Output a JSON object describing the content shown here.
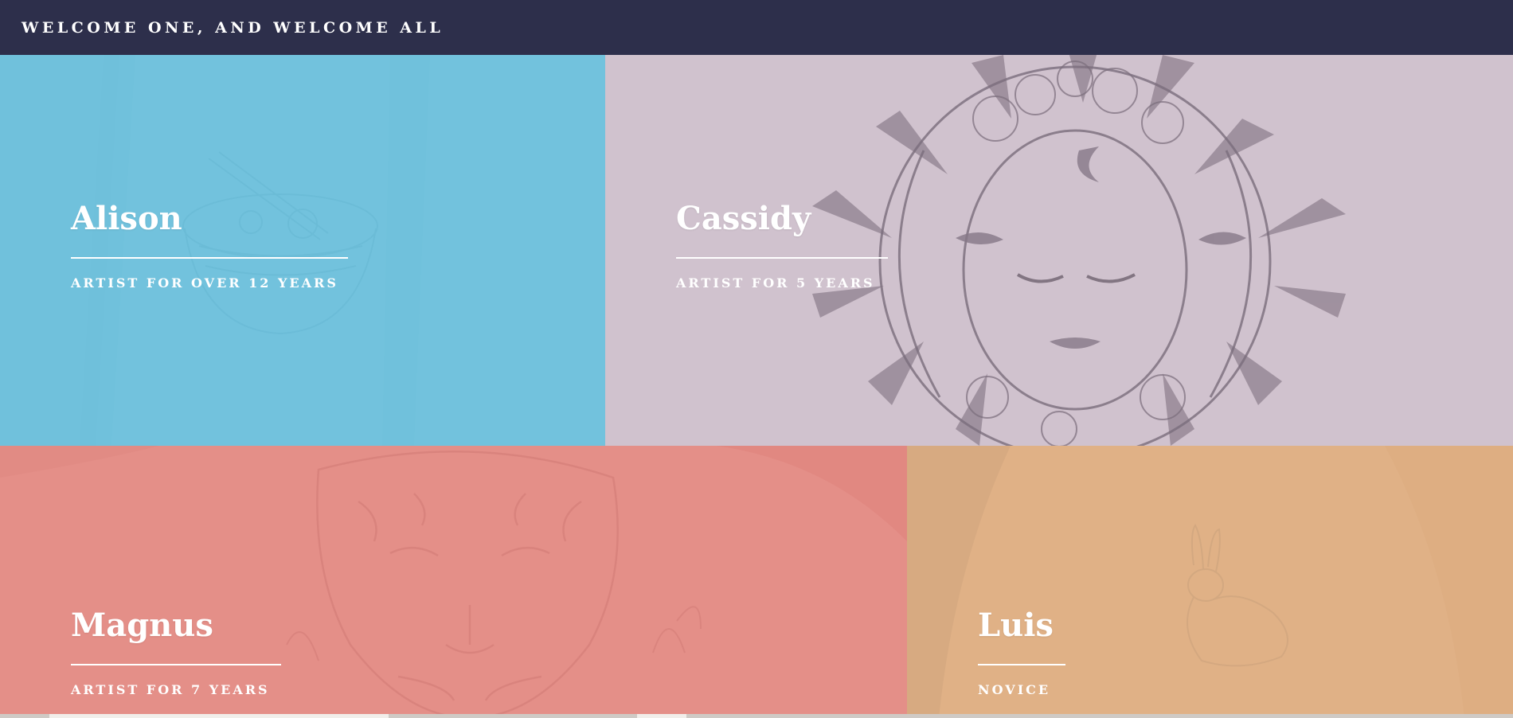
{
  "header": {
    "title": "WELCOME ONE, AND WELCOME ALL"
  },
  "artists": [
    {
      "name": "Alison",
      "meta": "ARTIST FOR OVER 12 YEARS",
      "overlay_color": "#6fc1dc",
      "artwork": "ramen-bowl-tattoo-image"
    },
    {
      "name": "Cassidy",
      "meta": "ARTIST FOR 5 YEARS",
      "overlay_color": "#d7c7d6",
      "artwork": "sun-moon-face-tattoo-image"
    },
    {
      "name": "Magnus",
      "meta": "ARTIST FOR 7 YEARS",
      "overlay_color": "#e58e86",
      "artwork": "tiger-tattoo-image"
    },
    {
      "name": "Luis",
      "meta": "NOVICE",
      "overlay_color": "#e0b187",
      "artwork": "rabbit-tattoo-image"
    }
  ]
}
